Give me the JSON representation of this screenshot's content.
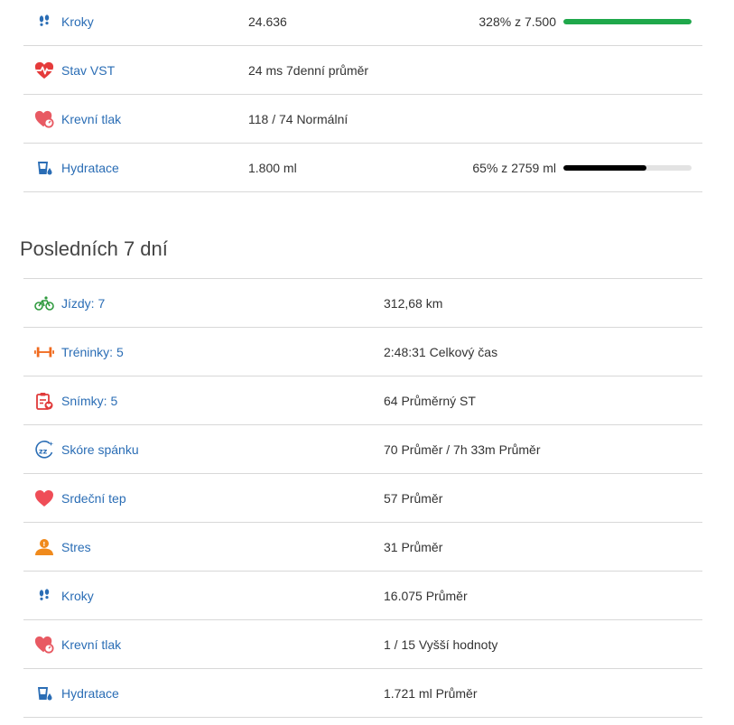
{
  "today": {
    "rows": [
      {
        "icon": "footsteps-icon",
        "label": "Kroky",
        "value": "24.636",
        "goal_text": "328% z 7.500",
        "goal_fraction": 1.0,
        "bar_color": "#1fa84b"
      },
      {
        "icon": "heart-pulse-icon",
        "label": "Stav VST",
        "value": "24 ms 7denní průměr"
      },
      {
        "icon": "heart-gauge-icon",
        "label": "Krevní tlak",
        "value": "118 / 74 Normální"
      },
      {
        "icon": "water-glass-icon",
        "label": "Hydratace",
        "value": "1.800 ml",
        "goal_text": "65% z 2759 ml",
        "goal_fraction": 0.65,
        "bar_color": "#000000"
      }
    ]
  },
  "last7": {
    "title": "Posledních 7 dní",
    "rows": [
      {
        "icon": "bicycle-icon",
        "label": "Jízdy: 7",
        "value": "312,68 km"
      },
      {
        "icon": "dumbbell-icon",
        "label": "Tréninky: 5",
        "value": "2:48:31 Celkový čas"
      },
      {
        "icon": "clipboard-heart-icon",
        "label": "Snímky: 5",
        "value": "64 Průměrný ST"
      },
      {
        "icon": "sleep-score-icon",
        "label": "Skóre spánku",
        "value": "70 Průměr / 7h 33m Průměr"
      },
      {
        "icon": "heart-icon",
        "label": "Srdeční tep",
        "value": "57 Průměr"
      },
      {
        "icon": "stress-person-icon",
        "label": "Stres",
        "value": "31 Průměr"
      },
      {
        "icon": "footsteps-icon",
        "label": "Kroky",
        "value": "16.075 Průměr"
      },
      {
        "icon": "heart-gauge-icon",
        "label": "Krevní tlak",
        "value": "1 / 15 Vyšší hodnoty"
      },
      {
        "icon": "water-glass-icon",
        "label": "Hydratace",
        "value": "1.721 ml Průměr"
      }
    ]
  },
  "colors": {
    "link": "#2a6db5",
    "divider": "#d8d8d8",
    "steps_bar": "#1fa84b",
    "hydration_bar": "#000000"
  }
}
